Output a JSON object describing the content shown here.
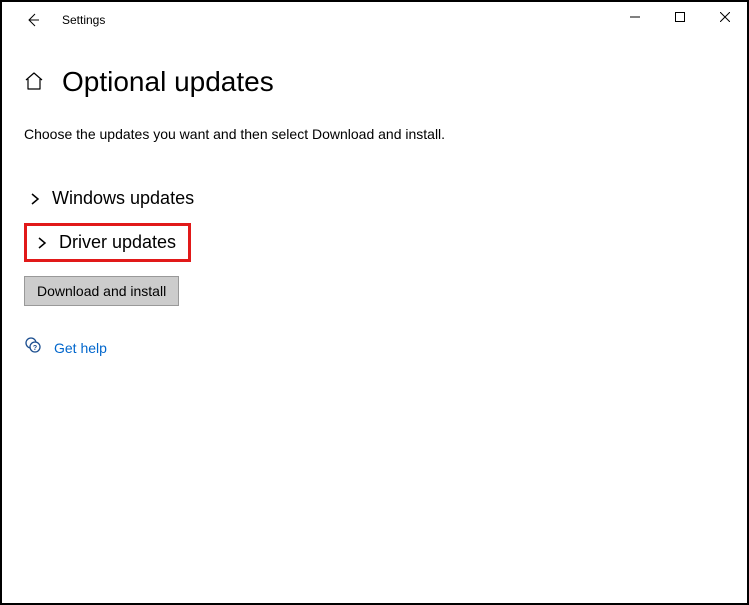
{
  "window": {
    "title": "Settings"
  },
  "page": {
    "heading": "Optional updates",
    "subtitle": "Choose the updates you want and then select Download and install."
  },
  "sections": {
    "windows_updates": {
      "label": "Windows updates"
    },
    "driver_updates": {
      "label": "Driver updates"
    }
  },
  "buttons": {
    "download_install": "Download and install"
  },
  "help": {
    "label": "Get help"
  }
}
